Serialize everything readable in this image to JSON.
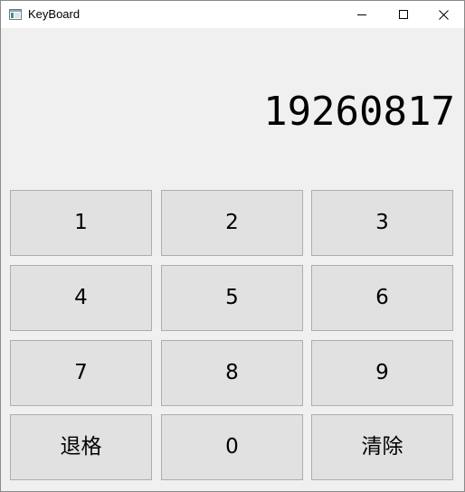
{
  "window": {
    "title": "KeyBoard",
    "controls": {
      "minimize_icon": "minimize-icon",
      "maximize_icon": "maximize-icon",
      "close_icon": "close-icon"
    }
  },
  "display": {
    "value": "19260817"
  },
  "keypad": {
    "rows": [
      [
        "1",
        "2",
        "3"
      ],
      [
        "4",
        "5",
        "6"
      ],
      [
        "7",
        "8",
        "9"
      ],
      [
        "退格",
        "0",
        "清除"
      ]
    ]
  },
  "colors": {
    "background": "#f0f0f0",
    "titlebar": "#ffffff",
    "key_face": "#e1e1e1",
    "key_border": "#adadad",
    "text": "#000000"
  }
}
